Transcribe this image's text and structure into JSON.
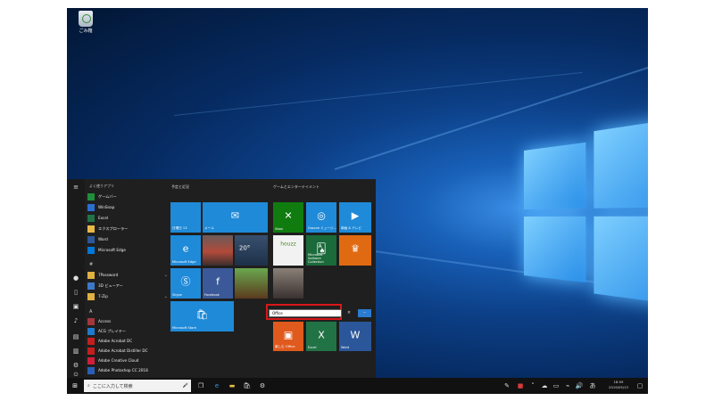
{
  "desktop": {
    "recycle_bin_label": "ごみ箱"
  },
  "start_menu": {
    "most_used_header": "よく使うアプリ",
    "most_used": [
      {
        "label": "ゲームバー",
        "color": "#1e8f3a"
      },
      {
        "label": "WinSnap",
        "color": "#2a6fd0"
      },
      {
        "label": "Excel",
        "color": "#217346"
      },
      {
        "label": "エクスプローラー",
        "color": "#e8b848"
      },
      {
        "label": "Word",
        "color": "#2b579a"
      },
      {
        "label": "Microsoft Edge",
        "color": "#0078d7"
      }
    ],
    "section_hash": "#",
    "hash_apps": [
      {
        "label": "7Password",
        "color": "#e0b040",
        "expand": "⌄"
      },
      {
        "label": "3D ビューアー",
        "color": "#3d78c8",
        "expand": ""
      },
      {
        "label": "7-Zip",
        "color": "#e0b040",
        "expand": "⌄"
      }
    ],
    "section_a": "A",
    "a_apps": [
      {
        "label": "Access",
        "color": "#a4373a"
      },
      {
        "label": "ACG プレイヤー",
        "color": "#1e7acc"
      },
      {
        "label": "Adobe Acrobat DC",
        "color": "#c41e1e"
      },
      {
        "label": "Adobe Acrobat Distiller DC",
        "color": "#c41e1e"
      },
      {
        "label": "Adobe Creative Cloud",
        "color": "#d01e3a"
      },
      {
        "label": "Adobe Photoshop CC 2018",
        "color": "#2a5db8"
      }
    ],
    "group_schedule": "予定と近況",
    "group_play": "ゲームとエンターテイメント",
    "tiles_left": {
      "calendar_day": "日曜日 13",
      "mail": "メール",
      "edge": "Microsoft Edge",
      "weather": "20°",
      "skype": "Skype",
      "facebook": "Facebook",
      "store": "Microsoft Store"
    },
    "tiles_right": {
      "xbox": "Xbox",
      "groove": "Groove ミュージ...",
      "movies": "映画 & テレビ",
      "houzz": "houzz",
      "solitaire": "Microsoft Solitaire Collection",
      "office": "楽しむ Office",
      "excel": "Excel",
      "word": "Word"
    },
    "search_value": "Office",
    "search_clear": "×",
    "search_more": "···"
  },
  "taskbar": {
    "search_placeholder": "ここに入力して検索",
    "time": "18:59",
    "date": "2019/05/13"
  }
}
